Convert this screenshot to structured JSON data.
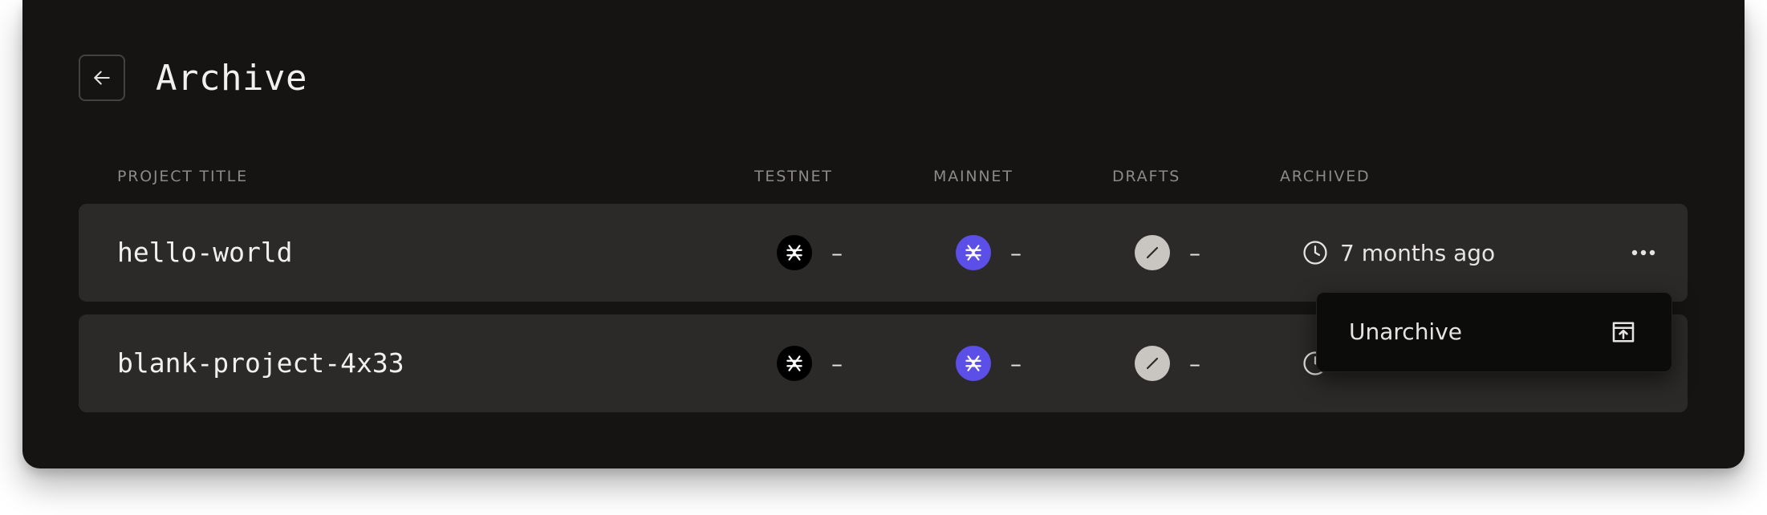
{
  "page": {
    "title": "Archive"
  },
  "table": {
    "headers": {
      "project_title": "PROJECT TITLE",
      "testnet": "TESTNET",
      "mainnet": "MAINNET",
      "drafts": "DRAFTS",
      "archived": "ARCHIVED"
    },
    "rows": [
      {
        "title": "hello-world",
        "testnet": "–",
        "mainnet": "–",
        "drafts": "–",
        "archived": "7 months ago"
      },
      {
        "title": "blank-project-4x33",
        "testnet": "–",
        "mainnet": "–",
        "drafts": "–",
        "archived": ""
      }
    ]
  },
  "context_menu": {
    "unarchive_label": "Unarchive"
  },
  "icons": {
    "back": "arrow-left-icon",
    "testnet": "stellar-icon",
    "mainnet": "stellar-icon",
    "drafts": "slash-icon",
    "archived": "clock-icon",
    "more": "more-horizontal-icon",
    "unarchive": "unarchive-box-icon"
  },
  "colors": {
    "background": "#151413",
    "row": "#2b2a28",
    "mainnet_badge": "#5b4fe8",
    "testnet_badge": "#000000",
    "drafts_badge": "#c9c6c2",
    "menu": "#0c0c0b"
  }
}
